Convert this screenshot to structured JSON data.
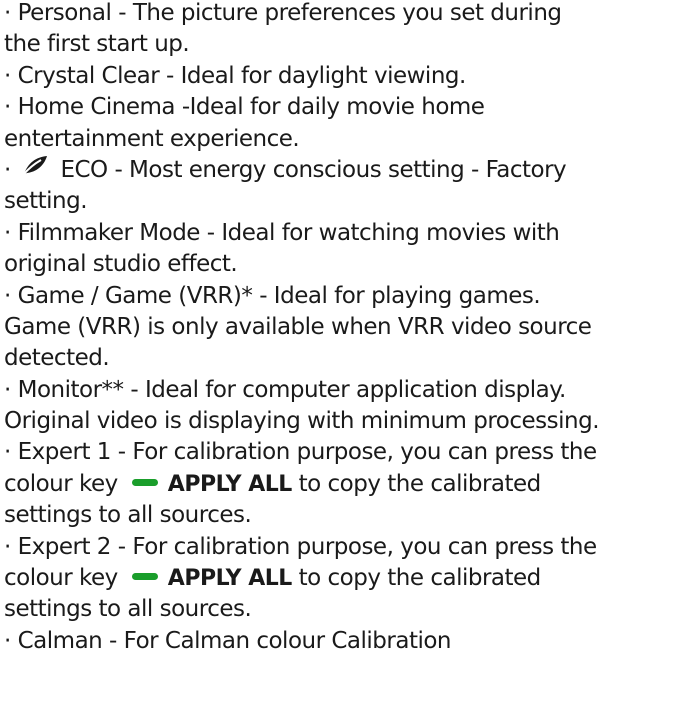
{
  "lines": [
    "· Personal - The picture preferences you set during",
    "the first start up.",
    "· Crystal Clear - Ideal for daylight viewing.",
    "· Home Cinema -Ideal for daily movie home",
    "entertainment experience.",
    "ECO - Most energy conscious setting - Factory",
    "setting.",
    "· Filmmaker Mode - Ideal for watching movies with",
    "original studio effect.",
    "· Game / Game (VRR)* - Ideal for playing games.",
    "Game (VRR) is only available when VRR video source",
    "detected.",
    "· Monitor** - Ideal for computer application display.",
    "Original video is displaying with minimum processing.",
    "· Expert 1 - For calibration purpose, you can press the",
    "colour key",
    "to copy the calibrated",
    "settings to all sources.",
    "· Expert 2 - For calibration purpose, you can press the",
    "colour key",
    "to copy the calibrated",
    "settings to all sources.",
    "· Calman - For Calman colour Calibration"
  ],
  "bullet": "·",
  "apply_all_label": "APPLY ALL",
  "icons": {
    "eco": "eco-leaf-icon",
    "green_key": "green-key-icon"
  },
  "colors": {
    "text": "#1a1a1a",
    "green_key": "#1a9e2b"
  }
}
